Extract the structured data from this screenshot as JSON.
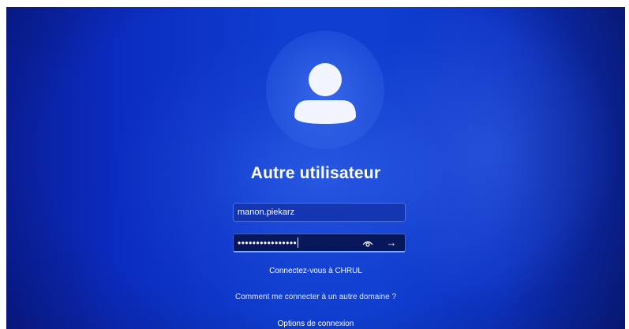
{
  "login": {
    "title": "Autre utilisateur",
    "username_value": "manon.piekarz",
    "password_mask": "••••••••••••••••",
    "connect_to": "Connectez-vous à CHRUL",
    "other_domain_link": "Comment me connecter à un autre domaine ?",
    "sign_in_options": "Options de connexion"
  },
  "icons": {
    "avatar": "user-avatar-icon",
    "reveal": "eye-icon",
    "submit": "arrow-right-icon"
  },
  "colors": {
    "background": "#0f3ed0",
    "field_background": "#1432aa",
    "text": "#ffffff"
  }
}
